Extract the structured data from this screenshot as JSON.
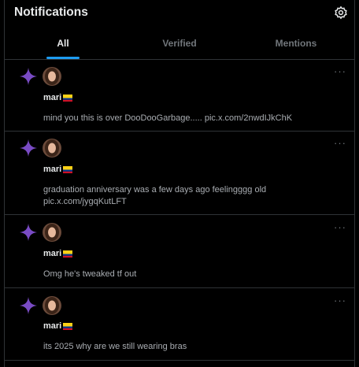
{
  "header": {
    "title": "Notifications",
    "settings_icon": "gear-icon"
  },
  "tabs": [
    {
      "label": "All",
      "active": true
    },
    {
      "label": "Verified",
      "active": false
    },
    {
      "label": "Mentions",
      "active": false
    }
  ],
  "colors": {
    "accent": "#1d9bf0",
    "sparkle": "#794bc4",
    "border": "#2f3336"
  },
  "notifications": [
    {
      "icon": "sparkle-icon",
      "name": "mari",
      "text": "mind you this is over DooDooGarbage..... pic.x.com/2nwdIJkChK"
    },
    {
      "icon": "sparkle-icon",
      "name": "mari",
      "text": "graduation anniversary was a few days ago feelingggg old pic.x.com/jygqKutLFT"
    },
    {
      "icon": "sparkle-icon",
      "name": "mari",
      "text": "Omg he's tweaked tf out"
    },
    {
      "icon": "sparkle-icon",
      "name": "mari",
      "text": "its 2025 why are we still wearing bras"
    }
  ]
}
